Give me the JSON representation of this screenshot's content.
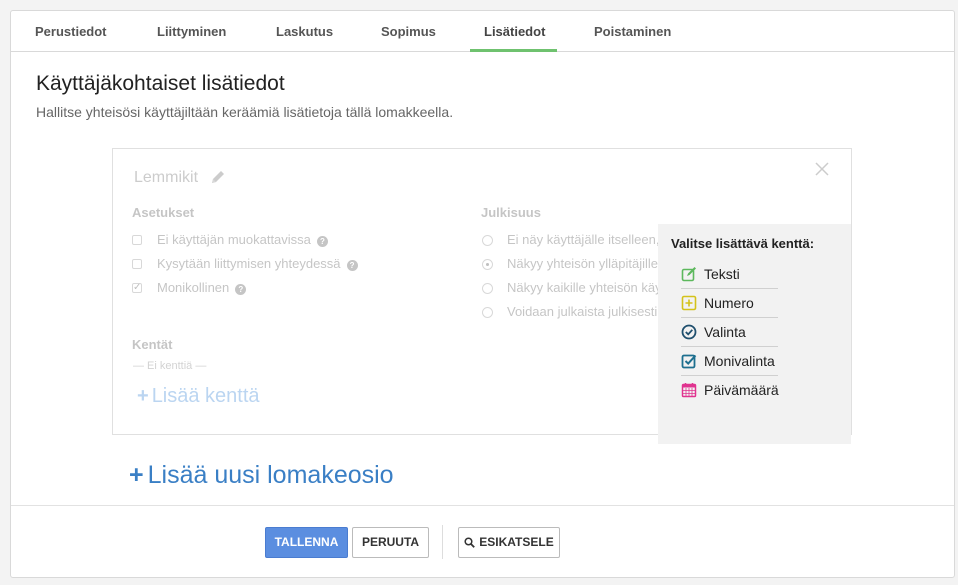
{
  "tabs": [
    {
      "label": "Perustiedot"
    },
    {
      "label": "Liittyminen"
    },
    {
      "label": "Laskutus"
    },
    {
      "label": "Sopimus"
    },
    {
      "label": "Lisätiedot",
      "active": true
    },
    {
      "label": "Poistaminen"
    }
  ],
  "page": {
    "title": "Käyttäjäkohtaiset lisätiedot",
    "subtitle": "Hallitse yhteisösi käyttäjiltään keräämiä lisätietoja tällä lomakkeella."
  },
  "section": {
    "name": "Lemmikit",
    "settings": {
      "title": "Asetukset",
      "options": [
        {
          "label": "Ei käyttäjän muokattavissa",
          "checked": false
        },
        {
          "label": "Kysytään liittymisen yhteydessä",
          "checked": false
        },
        {
          "label": "Monikollinen",
          "checked": true
        }
      ]
    },
    "visibility": {
      "title": "Julkisuus",
      "options": [
        {
          "label": "Ei näy käyttäjälle itselleen,",
          "checked": false
        },
        {
          "label": "Näkyy yhteisön ylläpitäjille",
          "checked": true
        },
        {
          "label": "Näkyy kaikille yhteisön käy",
          "checked": false
        },
        {
          "label": "Voidaan julkaista julkisesti",
          "checked": false
        }
      ]
    },
    "fields": {
      "title": "Kentät",
      "empty_text": "— Ei kenttiä —",
      "add_label": "Lisää kenttä"
    }
  },
  "field_picker": {
    "title": "Valitse lisättävä kenttä:",
    "items": [
      {
        "label": "Teksti",
        "icon": "edit-icon",
        "color": "#5cb85c"
      },
      {
        "label": "Numero",
        "icon": "plus-square-icon",
        "color": "#d4c21a"
      },
      {
        "label": "Valinta",
        "icon": "check-circle-icon",
        "color": "#1f4f6e"
      },
      {
        "label": "Monivalinta",
        "icon": "check-square-icon",
        "color": "#1d6f8f"
      },
      {
        "label": "Päivämäärä",
        "icon": "calendar-icon",
        "color": "#e0338f"
      }
    ]
  },
  "add_section_label": "Lisää uusi lomakeosio",
  "footer": {
    "save_label": "TALLENNA",
    "cancel_label": "PERUUTA",
    "preview_label": "ESIKATSELE"
  }
}
